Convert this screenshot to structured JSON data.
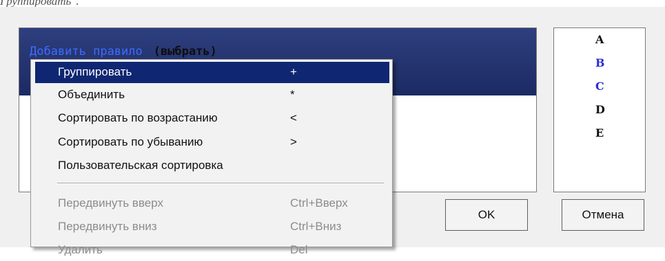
{
  "caption": "Группировать\".",
  "rule_panel": {
    "add_rule": "Добавить правило",
    "choose": "(выбрать)"
  },
  "letters": [
    {
      "text": "A",
      "color": "#111111"
    },
    {
      "text": "B",
      "color": "#2c2ccf"
    },
    {
      "text": "C",
      "color": "#2c2ccf"
    },
    {
      "text": "D",
      "color": "#111111"
    },
    {
      "text": "E",
      "color": "#111111"
    }
  ],
  "buttons": {
    "ok": "OK",
    "cancel": "Отмена"
  },
  "menu": {
    "items": [
      {
        "label": "Группировать",
        "shortcut": "+"
      },
      {
        "label": "Объединить",
        "shortcut": "*"
      },
      {
        "label": "Сортировать по возрастанию",
        "shortcut": "<"
      },
      {
        "label": "Сортировать по убыванию",
        "shortcut": ">"
      },
      {
        "label": "Пользовательская сортировка",
        "shortcut": ""
      },
      {
        "label": "Передвинуть вверх",
        "shortcut": "Ctrl+Вверх"
      },
      {
        "label": "Передвинуть вниз",
        "shortcut": "Ctrl+Вниз"
      },
      {
        "label": "Удалить",
        "shortcut": "Del"
      }
    ]
  },
  "colors": {
    "highlight": "#0f2672",
    "rule_row": "#1c2a63",
    "link": "#3d6bff",
    "letter_accent": "#2c2ccf",
    "disabled_text": "#8c8c8c"
  }
}
